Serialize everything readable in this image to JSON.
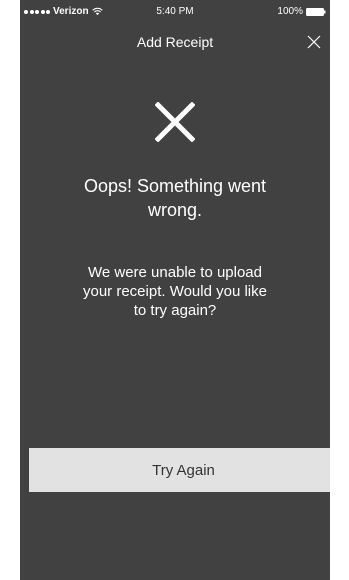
{
  "status_bar": {
    "carrier": "Verizon",
    "time": "5:40 PM",
    "battery": "100%",
    "signal_icon": "signal-dots-icon",
    "wifi_icon": "wifi-icon",
    "battery_icon": "battery-icon"
  },
  "header": {
    "title": "Add Receipt",
    "close_icon": "close-icon"
  },
  "error": {
    "icon": "error-x-icon",
    "title": "Oops! Something went wrong.",
    "message": "We were unable to upload your receipt. Would you like to try again?"
  },
  "actions": {
    "try_again_label": "Try Again"
  },
  "colors": {
    "background": "#414141",
    "button_bg": "#e2e2e2",
    "button_text": "#333333",
    "text": "#ffffff"
  }
}
